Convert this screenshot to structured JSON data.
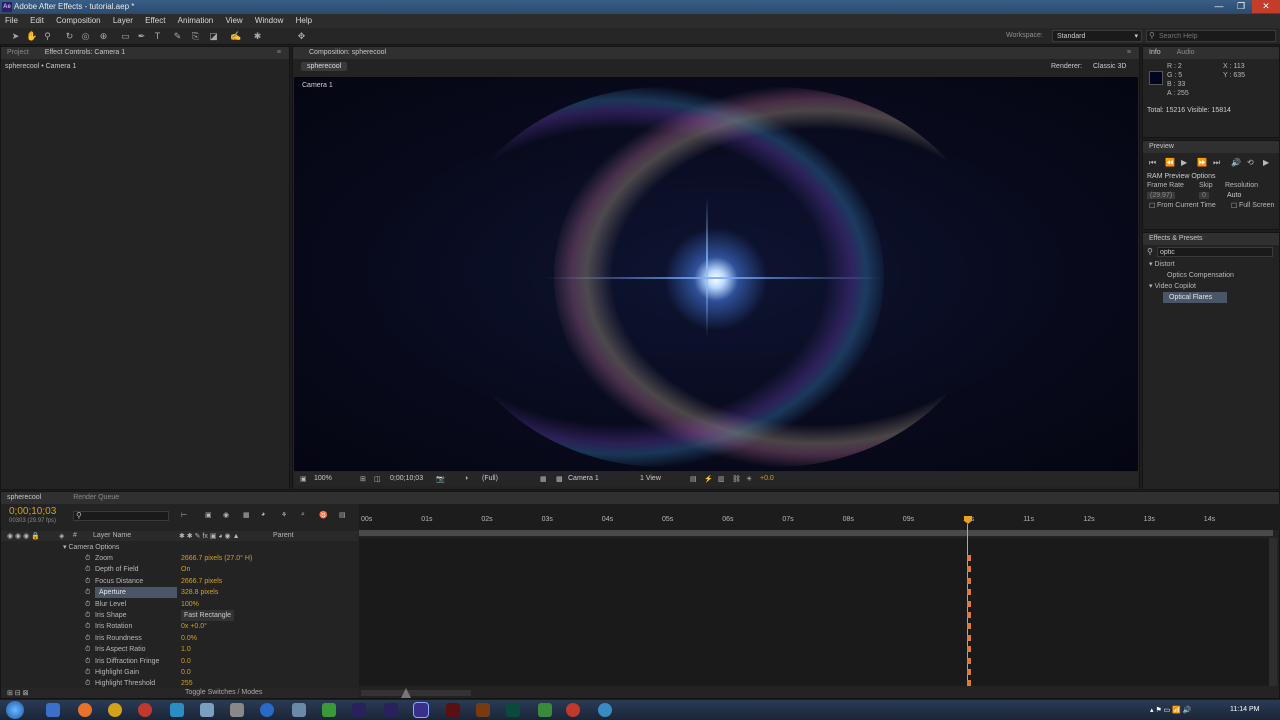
{
  "window": {
    "title": "Adobe After Effects - tutorial.aep *",
    "minimize": "—",
    "maximize": "❐",
    "close": "✕"
  },
  "menu": [
    "File",
    "Edit",
    "Composition",
    "Layer",
    "Effect",
    "Animation",
    "View",
    "Window",
    "Help"
  ],
  "toolbar": {
    "workspace_label": "Workspace:",
    "workspace_value": "Standard",
    "search_placeholder": "Search Help"
  },
  "left_panel": {
    "tab_project": "Project",
    "tab_effect_controls": "Effect Controls: Camera 1",
    "breadcrumb": "spherecool • Camera 1"
  },
  "comp_panel": {
    "tab": "Composition: spherecool",
    "subtab": "spherecool",
    "renderer_label": "Renderer:",
    "renderer_value": "Classic 3D",
    "camera_label": "Camera 1",
    "footer": {
      "zoom": "100%",
      "timecode": "0;00;10;03",
      "resolution": "(Full)",
      "camera": "Camera 1",
      "views": "1 View",
      "exposure": "+0.0"
    }
  },
  "info_panel": {
    "tab_info": "Info",
    "tab_audio": "Audio",
    "r": "R : 2",
    "g": "G : 5",
    "b": "B : 33",
    "a": "A : 255",
    "x": "X : 113",
    "y": "Y : 635",
    "totals": "Total: 15216  Visible: 15814"
  },
  "preview_panel": {
    "tab": "Preview",
    "ram_options": "RAM Preview Options",
    "frame_rate_label": "Frame Rate",
    "skip_label": "Skip",
    "resolution_label": "Resolution",
    "frame_rate_value": "(29.97)",
    "skip_value": "0",
    "resolution_value": "Auto",
    "from_current": "From Current Time",
    "full_screen": "Full Screen"
  },
  "effects_panel": {
    "tab": "Effects & Presets",
    "search_value": "optic",
    "items": [
      {
        "label": "Distort",
        "type": "group"
      },
      {
        "label": "Optics Compensation",
        "type": "item"
      },
      {
        "label": "Video Copilot",
        "type": "group"
      },
      {
        "label": "Optical Flares",
        "type": "item-selected"
      }
    ]
  },
  "timeline": {
    "tab": "spherecool",
    "tab_render": "Render Queue",
    "timecode": "0;00;10;03",
    "timecode_sub": "00303 (29.97 fps)",
    "col_layer": "Layer Name",
    "col_parent": "Parent",
    "group": "Camera Options",
    "props": [
      {
        "name": "Zoom",
        "value": "2666.7 pixels (27.0° H)"
      },
      {
        "name": "Depth of Field",
        "value": "On"
      },
      {
        "name": "Focus Distance",
        "value": "2666.7 pixels"
      },
      {
        "name": "Aperture",
        "value": "328.8 pixels",
        "selected": true
      },
      {
        "name": "Blur Level",
        "value": "100%"
      },
      {
        "name": "Iris Shape",
        "value": "Fast Rectangle"
      },
      {
        "name": "Iris Rotation",
        "value": "0x +0.0°"
      },
      {
        "name": "Iris Roundness",
        "value": "0.0%"
      },
      {
        "name": "Iris Aspect Ratio",
        "value": "1.0"
      },
      {
        "name": "Iris Diffraction Fringe",
        "value": "0.0"
      },
      {
        "name": "Highlight Gain",
        "value": "0.0"
      },
      {
        "name": "Highlight Threshold",
        "value": "255"
      }
    ],
    "ruler": [
      "00s",
      "01s",
      "02s",
      "03s",
      "04s",
      "05s",
      "06s",
      "07s",
      "08s",
      "09s",
      "10s",
      "11s",
      "12s",
      "13s",
      "14s"
    ],
    "toggle": "Toggle Switches / Modes"
  },
  "taskbar": {
    "time": "11:14 PM"
  },
  "colors": {
    "accent": "#d4a11a",
    "playhead": "#e8a21e",
    "keyframe": "#e07a3a"
  }
}
